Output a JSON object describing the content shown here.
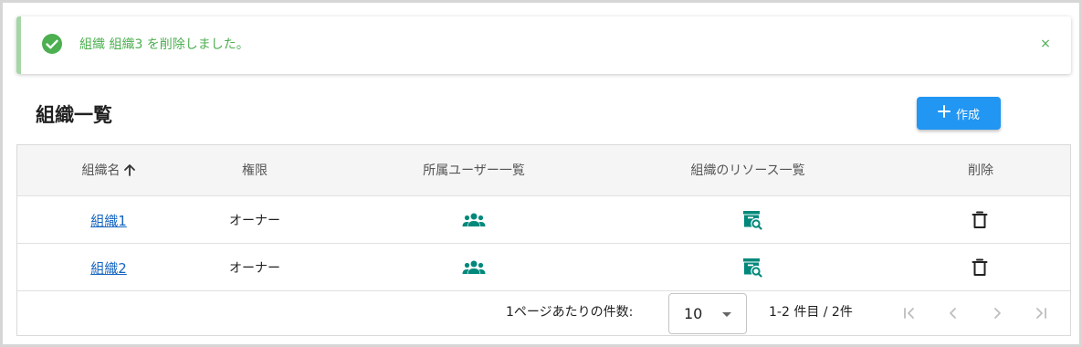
{
  "alert": {
    "message": "組織 組織3 を削除しました。",
    "close_label": "×",
    "icon": "check-circle-icon",
    "color": "#4caf50"
  },
  "header": {
    "title": "組織一覧",
    "create_label": "作成",
    "create_icon": "plus-icon",
    "accent": "#2196f3"
  },
  "table": {
    "columns": [
      "組織名",
      "権限",
      "所属ユーザー一覧",
      "組織のリソース一覧",
      "削除"
    ],
    "sort_indicator": "↑",
    "rows": [
      {
        "name": "組織1",
        "role": "オーナー"
      },
      {
        "name": "組織2",
        "role": "オーナー"
      }
    ],
    "icons": {
      "members": "group-icon",
      "resources": "resource-search-icon",
      "delete": "trash-icon"
    },
    "icon_color": "#00897b"
  },
  "pagination": {
    "rows_per_page_label": "1ページあたりの件数:",
    "rows_per_page": "10",
    "range": "1-2 件目 / 2件"
  }
}
